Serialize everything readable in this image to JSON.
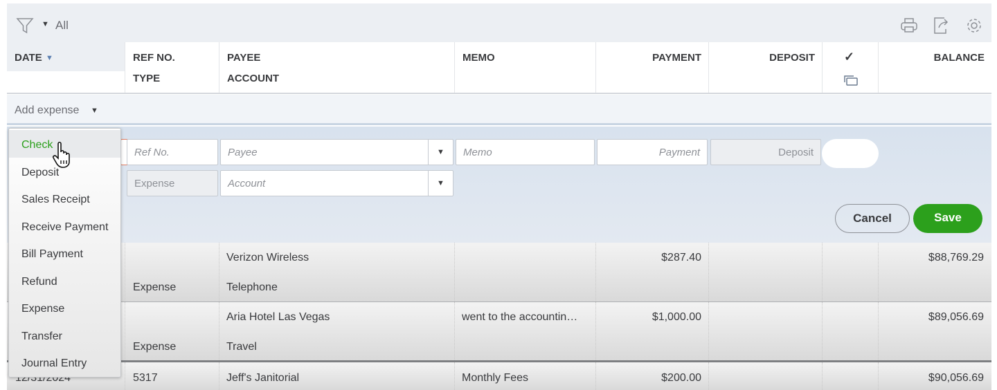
{
  "toolbar": {
    "filter_value": "All",
    "icons": [
      "filter-icon",
      "print-icon",
      "export-icon",
      "gear-icon"
    ]
  },
  "columns": {
    "date": "DATE",
    "ref": "REF NO.",
    "type": "TYPE",
    "payee": "PAYEE",
    "account": "ACCOUNT",
    "memo": "MEMO",
    "payment": "PAYMENT",
    "deposit": "DEPOSIT",
    "check": "✓",
    "balance": "BALANCE"
  },
  "add_expense": "Add expense",
  "form": {
    "ref_placeholder": "Ref No.",
    "payee_placeholder": "Payee",
    "memo_placeholder": "Memo",
    "payment_placeholder": "Payment",
    "deposit_placeholder": "Deposit",
    "type_value": "Expense",
    "account_placeholder": "Account",
    "cancel": "Cancel",
    "save": "Save"
  },
  "menu": {
    "items": [
      "Check",
      "Deposit",
      "Sales Receipt",
      "Receive Payment",
      "Bill Payment",
      "Refund",
      "Expense",
      "Transfer",
      "Journal Entry"
    ],
    "highlighted": "Check"
  },
  "rows": [
    {
      "date": "",
      "ref": "",
      "type": "Expense",
      "payee": "Verizon Wireless",
      "account": "Telephone",
      "memo": "",
      "payment": "$287.40",
      "deposit": "",
      "balance": "$88,769.29"
    },
    {
      "date": "",
      "ref": "",
      "type": "Expense",
      "payee": "Aria Hotel Las Vegas",
      "account": "Travel",
      "memo": "went to the accountin…",
      "payment": "$1,000.00",
      "deposit": "",
      "balance": "$89,056.69"
    },
    {
      "date": "12/31/2024",
      "ref": "5317",
      "type": "",
      "payee": "Jeff's Janitorial",
      "account": "",
      "memo": "Monthly Fees",
      "payment": "$200.00",
      "deposit": "",
      "balance": "$90,056.69"
    }
  ],
  "colors": {
    "accent_green": "#2ca01c",
    "header_bg": "#eceff3",
    "edit_bg": "#d8e2ee"
  }
}
